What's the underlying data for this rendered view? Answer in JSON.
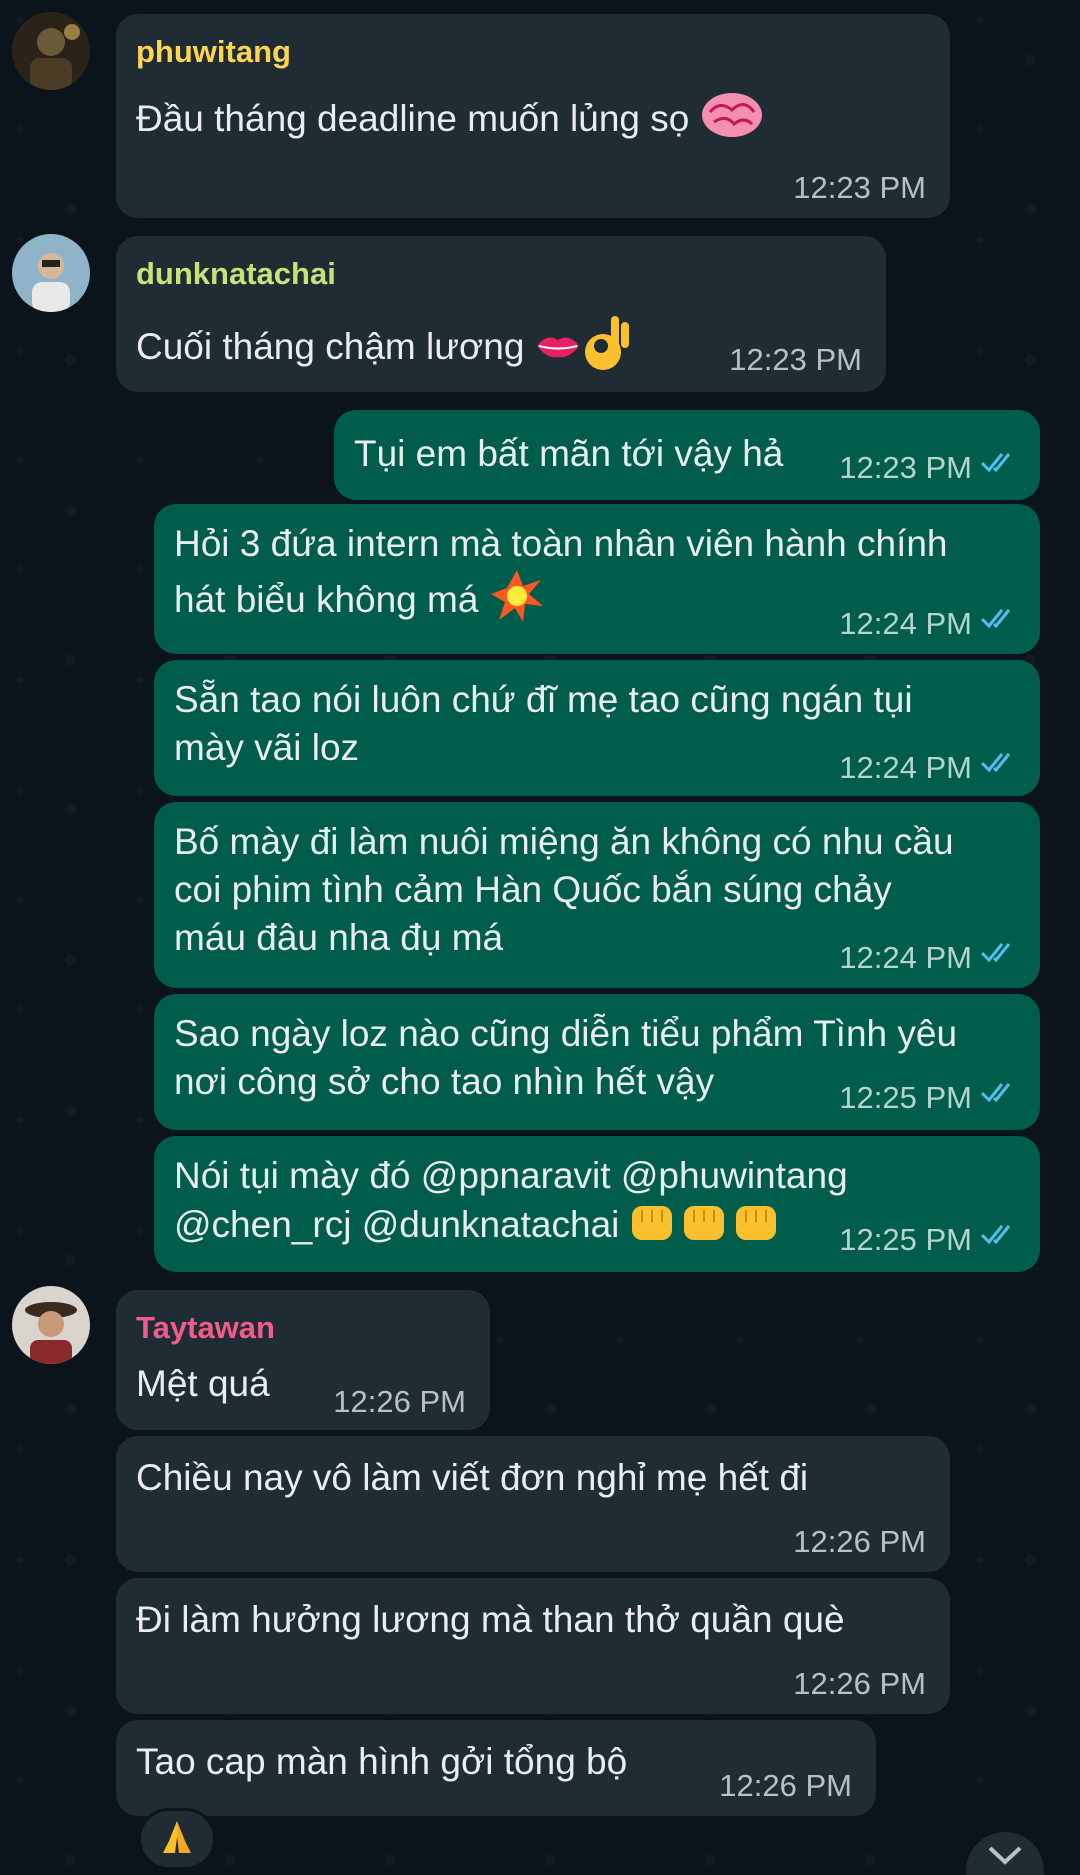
{
  "messages": [
    {
      "sender": "phuwitang",
      "sender_color": "#ffd54f",
      "text": "Đầu tháng deadline muốn lủng sọ",
      "emoji": "brain-icon",
      "time": "12:23 PM"
    },
    {
      "sender": "dunknatachai",
      "sender_color": "#c5e478",
      "text": "Cuối tháng chậm lương",
      "emoji": "lips-okhand-icon",
      "time": "12:23 PM"
    },
    {
      "text": "Tụi em bất mãn tới vậy hả",
      "time": "12:23 PM"
    },
    {
      "text": "Hỏi 3 đứa intern mà toàn nhân viên hành chính\nhát biểu không má",
      "emoji": "collision-icon",
      "time": "12:24 PM"
    },
    {
      "text": "Sẵn tao nói luôn chứ đĩ mẹ tao cũng ngán tụi\nmày vãi loz",
      "time": "12:24 PM"
    },
    {
      "text": "Bố mày đi làm nuôi miệng ăn không có nhu cầu\ncoi phim tình cảm Hàn Quốc bắn súng chảy\nmáu đâu nha đụ má",
      "time": "12:24 PM"
    },
    {
      "text": "Sao ngày loz nào cũng diễn tiểu phẩm Tình yêu\nnơi công sở cho tao nhìn hết vậy",
      "time": "12:25 PM"
    },
    {
      "text": "Nói tụi mày đó @ppnaravit @phuwintang\n@chen_rcj @dunknatachai",
      "emoji": "fist-icon",
      "time": "12:25 PM"
    },
    {
      "sender": "Taytawan",
      "sender_color": "#f15c8d",
      "text": "Mệt quá",
      "time": "12:26 PM"
    },
    {
      "text": "Chiều nay vô làm viết đơn nghỉ mẹ hết đi",
      "time": "12:26 PM"
    },
    {
      "text": "Đi làm hưởng lương mà than thở quần què",
      "time": "12:26 PM"
    },
    {
      "text": "Tao cap màn hình gởi tổng bộ",
      "time": "12:26 PM"
    }
  ],
  "reaction": "folded-hands-icon",
  "colors": {
    "background": "#0b141a",
    "incoming": "#1f2c34",
    "outgoing": "#005c4b",
    "read_ticks": "#53bdeb"
  }
}
